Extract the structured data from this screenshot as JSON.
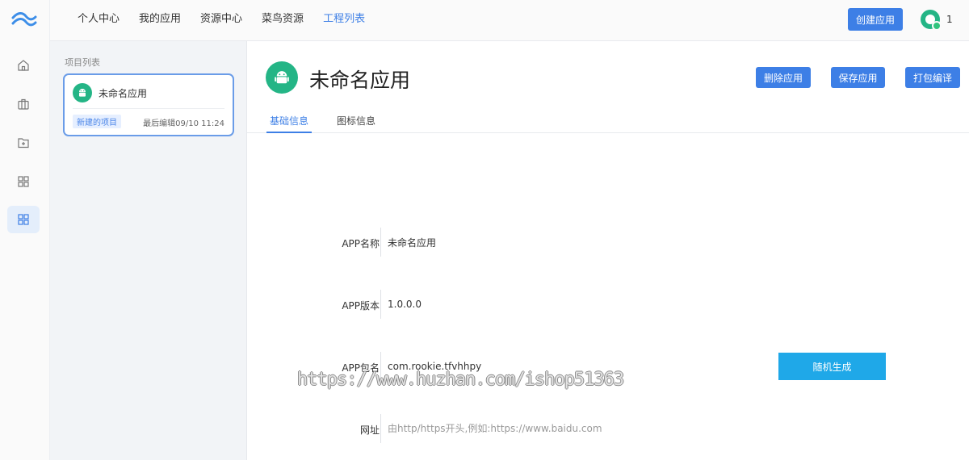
{
  "topnav": {
    "items": [
      "个人中心",
      "我的应用",
      "资源中心",
      "菜鸟资源",
      "工程列表"
    ],
    "active_index": 4,
    "create_button": "创建应用",
    "avatar_count": "1"
  },
  "rail": {
    "icons": [
      "logo-icon",
      "home-icon",
      "briefcase-icon",
      "folder-add-icon",
      "apps-grid-icon",
      "apps-grid-icon"
    ],
    "active_index": 4
  },
  "project_panel": {
    "title": "项目列表",
    "card": {
      "name": "未命名应用",
      "badge": "新建的项目",
      "last_edit": "最后编辑09/10 11:24"
    }
  },
  "app": {
    "title": "未命名应用",
    "buttons": {
      "delete": "删除应用",
      "save": "保存应用",
      "build": "打包编译"
    },
    "tabs": [
      "基础信息",
      "图标信息"
    ],
    "active_tab": 0
  },
  "form": {
    "name_label": "APP名称",
    "name_value": "未命名应用",
    "version_label": "APP版本",
    "version_value": "1.0.0.0",
    "package_label": "APP包名",
    "package_value": "com.rookie.tfvhhpy",
    "url_label": "网址",
    "url_placeholder": "由http/https开头,例如:https://www.baidu.com",
    "random_button": "随机生成"
  },
  "watermark": "https://www.huzhan.com/ishop51363",
  "colors": {
    "primary": "#3d7fe6",
    "accent_cyan": "#1fa8e8",
    "android_green": "#24b586"
  }
}
